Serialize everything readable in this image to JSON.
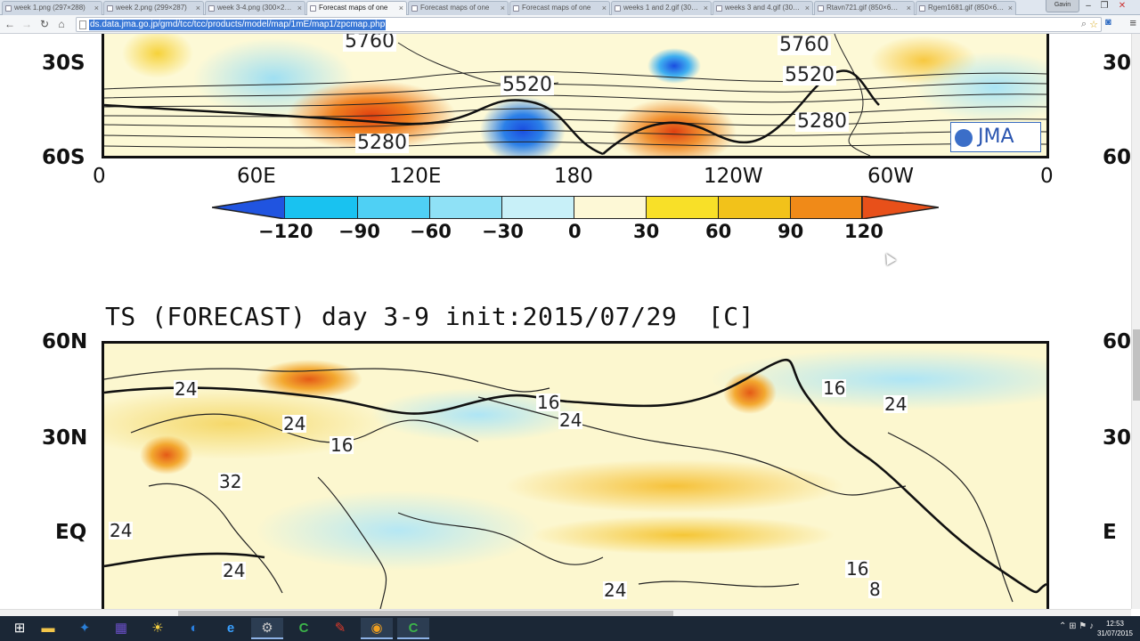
{
  "browser": {
    "tabs": [
      {
        "title": "week 1.png (297×288)",
        "active": false
      },
      {
        "title": "week 2.png (299×287)",
        "active": false
      },
      {
        "title": "week 3-4.png (300×2…",
        "active": false
      },
      {
        "title": "Forecast maps of one",
        "active": true
      },
      {
        "title": "Forecast maps of one",
        "active": false
      },
      {
        "title": "Forecast maps of one",
        "active": false
      },
      {
        "title": "weeks 1 and 2.gif (30…",
        "active": false
      },
      {
        "title": "weeks 3 and 4.gif (30…",
        "active": false
      },
      {
        "title": "Rtavn721.gif (850×6…",
        "active": false
      },
      {
        "title": "Rgem1681.gif (850×6…",
        "active": false
      }
    ],
    "tab_close_glyph": "×",
    "profile_name": "Gavin",
    "window_controls": {
      "minimize": "–",
      "restore": "❐",
      "close": "✕"
    },
    "nav": {
      "back": "←",
      "forward": "→",
      "reload": "↻",
      "home": "⌂"
    },
    "url": "ds.data.jma.go.jp/gmd/tcc/tcc/products/model/map/1mE/map1/zpcmap.php",
    "omnibox_icons": {
      "search": "⌕",
      "star": "☆"
    },
    "menu_glyph": "≡"
  },
  "top_map": {
    "lat_labels": [
      "30S",
      "60S"
    ],
    "lon_labels": [
      "0",
      "60E",
      "120E",
      "180",
      "120W",
      "60W",
      "0"
    ],
    "edge_lat_labels": [
      "30",
      "60"
    ],
    "contour_labels": [
      "5760",
      "5520",
      "5280",
      "5760",
      "5520",
      "5280"
    ],
    "logo_text": "JMA",
    "colorbar": {
      "ticks": [
        "−120",
        "−90",
        "−60",
        "−30",
        "0",
        "30",
        "60",
        "90",
        "120"
      ],
      "colors": [
        "#2054e0",
        "#19c2f0",
        "#4fd0f4",
        "#8fe1f6",
        "#c8f0f8",
        "#fdf8d6",
        "#f8e028",
        "#f2c21a",
        "#f08a18",
        "#e8501a"
      ]
    }
  },
  "bottom_map": {
    "title": "TS (FORECAST) day 3-9 init:2015/07/29  [C]",
    "lat_labels": [
      "60N",
      "30N",
      "EQ"
    ],
    "edge_lat_labels": [
      "60",
      "30",
      "E"
    ],
    "contour_labels": [
      "24",
      "24",
      "16",
      "32",
      "24",
      "24",
      "16",
      "24",
      "16",
      "24",
      "24",
      "16",
      "8"
    ]
  },
  "taskbar": {
    "start_glyph": "⊞",
    "apps": [
      {
        "name": "file-explorer",
        "glyph": "▬",
        "open": false
      },
      {
        "name": "app-blue-bird",
        "glyph": "✦",
        "open": false
      },
      {
        "name": "app-calculator",
        "glyph": "▦",
        "open": false
      },
      {
        "name": "app-sun",
        "glyph": "☀",
        "open": false
      },
      {
        "name": "app-swirl",
        "glyph": "◐",
        "open": false
      },
      {
        "name": "internet-explorer",
        "glyph": "e",
        "open": false
      },
      {
        "name": "app-gear",
        "glyph": "⚙",
        "open": true
      },
      {
        "name": "app-green-c",
        "glyph": "C",
        "open": false
      },
      {
        "name": "app-paint",
        "glyph": "✎",
        "open": false
      },
      {
        "name": "chrome",
        "glyph": "◉",
        "open": true
      },
      {
        "name": "app-green-c-2",
        "glyph": "C",
        "open": true
      }
    ],
    "tray": "⌃ ⊞ ⚑ ♪",
    "time": "12:53",
    "date": "31/07/2015"
  }
}
